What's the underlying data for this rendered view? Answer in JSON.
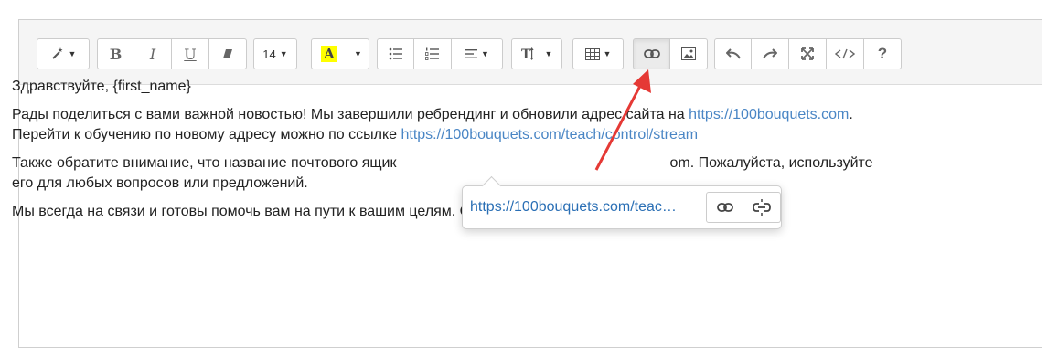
{
  "toolbar": {
    "font_size": "14",
    "highlight_letter": "A",
    "help_label": "?"
  },
  "content": {
    "greeting": "Здравствуйте, {first_name}",
    "p2_text1": "Рады поделиться с вами важной новостью! Мы завершили ребрендинг и обновили адрес сайта на ",
    "p2_link1": "https://100bouquets.com",
    "p2_text2": ".",
    "p2_text3": "Перейти к обучению по новому адресу можно по ссылке ",
    "p2_link2": "https://100bouquets.com/teach/control/stream",
    "p3_text_a": "Также обратите внимание, что название почтового ящик",
    "p3_text_b": "om. Пожалуйста, используйте",
    "p3_text_c": "его для любых вопросов или предложений.",
    "p4_text": "Мы всегда на связи и готовы помочь вам на пути к вашим целям. Спасибо, что остаетесь с нами!"
  },
  "link_popover": {
    "url": "https://100bouquets.com/teac…"
  },
  "colors": {
    "link": "#4a86c5",
    "annotation_arrow": "#e53935",
    "highlight": "#ffff00"
  }
}
